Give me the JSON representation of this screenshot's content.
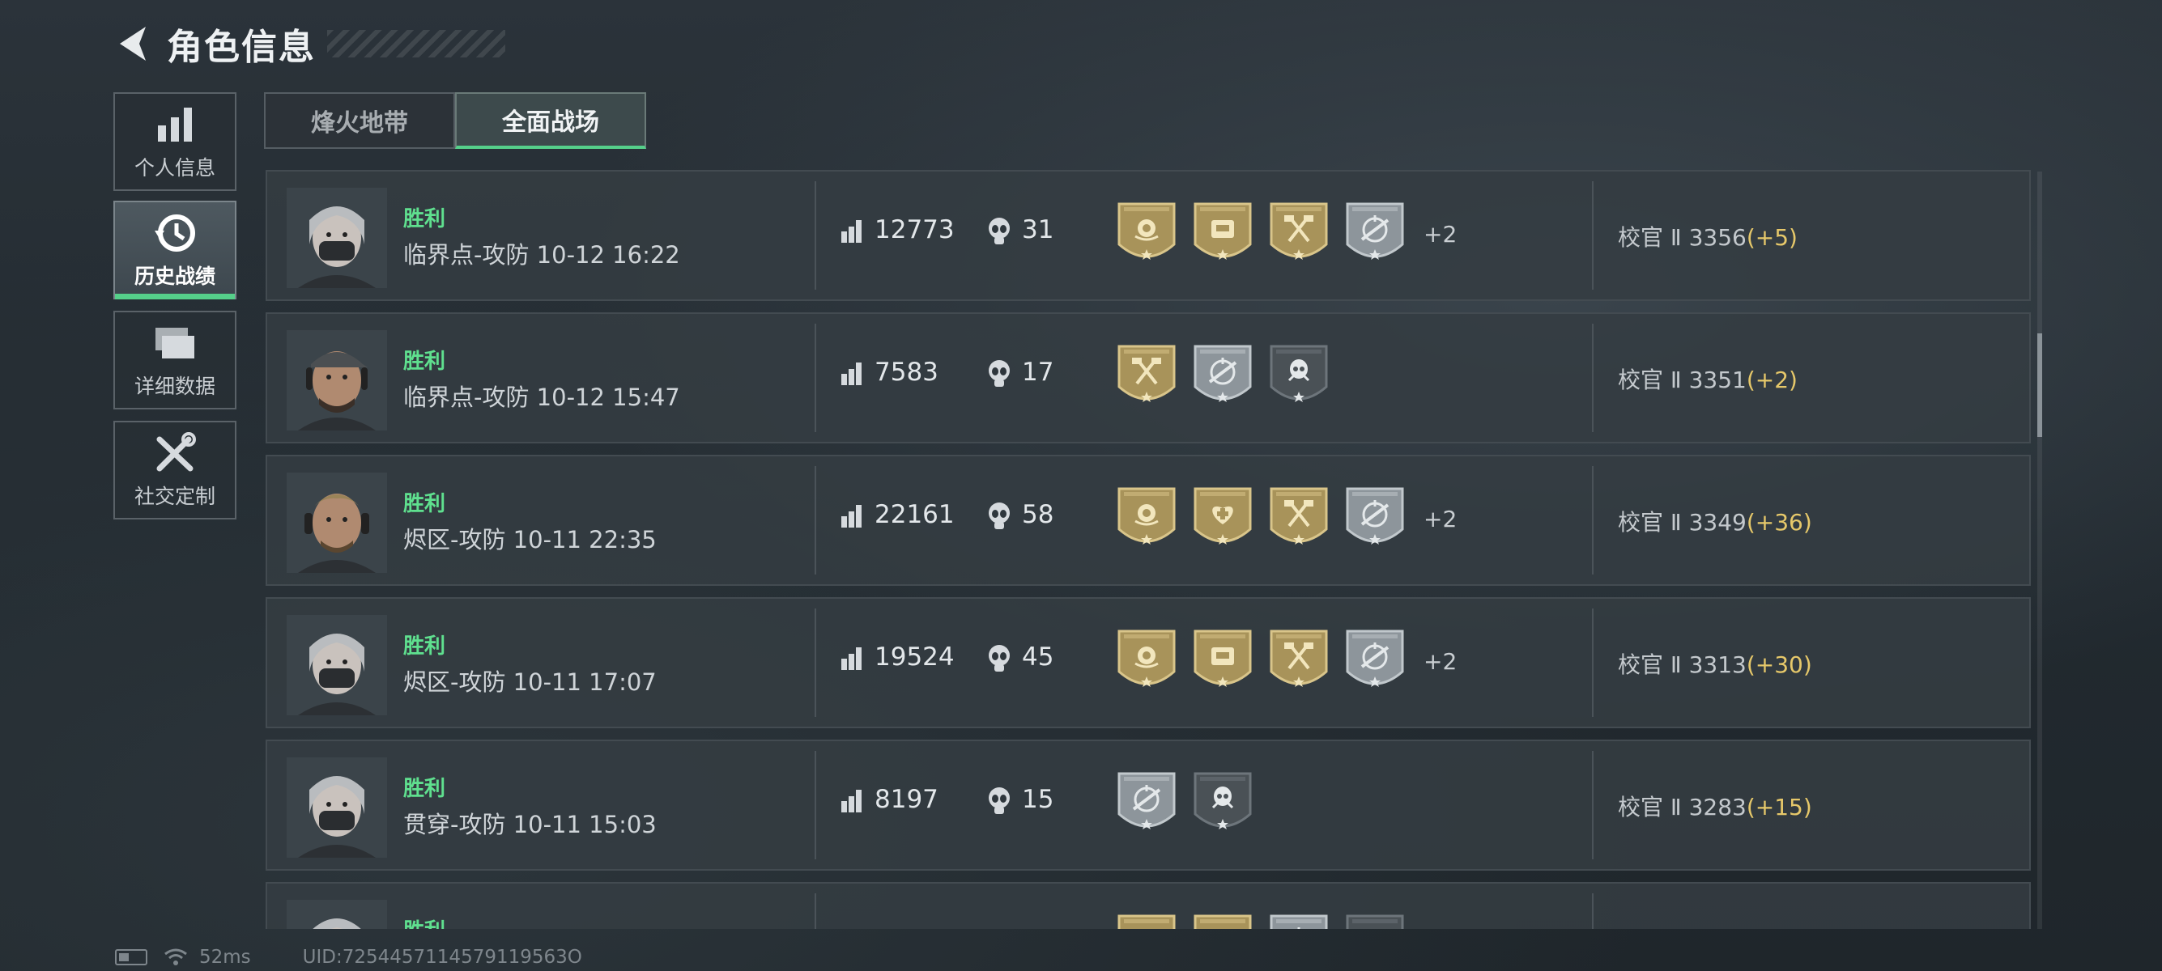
{
  "header": {
    "title": "角色信息"
  },
  "sidebar": {
    "items": [
      {
        "label": "个人信息",
        "icon": "bar-chart-icon",
        "active": false
      },
      {
        "label": "历史战绩",
        "icon": "history-clock-icon",
        "active": true
      },
      {
        "label": "详细数据",
        "icon": "folder-icon",
        "active": false
      },
      {
        "label": "社交定制",
        "icon": "tools-icon",
        "active": false
      }
    ]
  },
  "tabs": [
    {
      "label": "烽火地带",
      "active": false
    },
    {
      "label": "全面战场",
      "active": true
    }
  ],
  "matches": [
    {
      "result": "胜利",
      "match": "临界点-攻防 10-12 16:22",
      "score": "12773",
      "kills": "31",
      "medals": [
        "gold-rose",
        "gold-crate",
        "gold-axes",
        "silver-crosshair"
      ],
      "extra": "+2",
      "rank": "校官 Ⅱ 3356",
      "delta": "(+5)",
      "avatar": "female-masked"
    },
    {
      "result": "胜利",
      "match": "临界点-攻防 10-12 15:47",
      "score": "7583",
      "kills": "17",
      "medals": [
        "gold-axes",
        "silver-crosshair",
        "dark-skull"
      ],
      "extra": "",
      "rank": "校官 Ⅱ 3351",
      "delta": "(+2)",
      "avatar": "male-cap"
    },
    {
      "result": "胜利",
      "match": "烬区-攻防 10-11 22:35",
      "score": "22161",
      "kills": "58",
      "medals": [
        "gold-rose",
        "gold-medic",
        "gold-axes",
        "silver-crosshair"
      ],
      "extra": "+2",
      "rank": "校官 Ⅱ 3349",
      "delta": "(+36)",
      "avatar": "male-blond"
    },
    {
      "result": "胜利",
      "match": "烬区-攻防 10-11 17:07",
      "score": "19524",
      "kills": "45",
      "medals": [
        "gold-rose",
        "gold-crate",
        "gold-axes",
        "silver-crosshair"
      ],
      "extra": "+2",
      "rank": "校官 Ⅱ 3313",
      "delta": "(+30)",
      "avatar": "female-masked"
    },
    {
      "result": "胜利",
      "match": "贯穿-攻防 10-11 15:03",
      "score": "8197",
      "kills": "15",
      "medals": [
        "silver-crosshair",
        "dark-skull"
      ],
      "extra": "",
      "rank": "校官 Ⅱ 3283",
      "delta": "(+15)",
      "avatar": "female-masked"
    },
    {
      "result": "胜利",
      "match": "",
      "score": "",
      "kills": "",
      "medals": [
        "gold-rose",
        "gold-crate",
        "silver-crosshair",
        "dark-skull"
      ],
      "extra": "",
      "rank": "",
      "delta": "",
      "avatar": "female-masked"
    }
  ],
  "status": {
    "ping": "52ms",
    "uid": "UID:7254457114579119563O"
  },
  "colors": {
    "accent": "#55d08a",
    "victory": "#5fe08f",
    "gold": "#c9b06a",
    "delta": "#e6c86a"
  }
}
